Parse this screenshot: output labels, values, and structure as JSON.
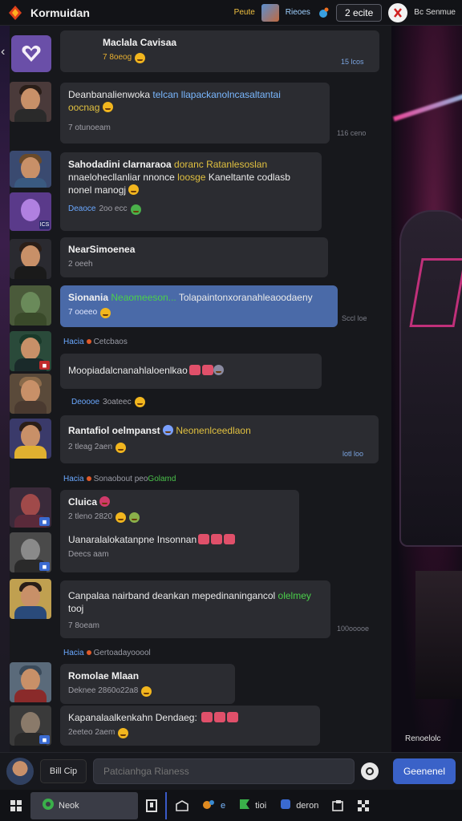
{
  "topbar": {
    "title": "Kormuidan",
    "link": "Peute",
    "chip": "Rieoes",
    "pill": "2 ecite",
    "user": "Bc Senmue"
  },
  "messages": [
    {
      "name": "Maclala Cavisaa",
      "meta": "7 8oeog",
      "stamp": "15 lcos"
    },
    {
      "text_a": "Deanbanalienwoka ",
      "text_b": "telcan llapackanolncasaltantai",
      "text_c": "oocnag",
      "meta": "7 otunoeam",
      "stamp": "116 ceno"
    },
    {
      "text_a": "Sahodadini clarnaraoa",
      "text_b": " doranc Ratanlesoslan",
      "text_c": "nnaelohecllanliar nnonce ",
      "text_d": "loosge",
      "text_e": " Kaneltante codlasb",
      "text_f": "nonel manogj",
      "meta": "Deaoce",
      "meta2": "2oo ecc"
    },
    {
      "name": "NearSimoenea",
      "meta": "2 oeeh"
    },
    {
      "name": "Sionania",
      "text_b": " Neaomeeson...",
      "text_c": " Tolapaintonxoranahleaoodaeny",
      "meta": "7 ooeeo",
      "stamp": "Sccl loe"
    },
    {
      "sys_a": "Hacia",
      "sys_b": "Cetcbaos"
    },
    {
      "text_a": "Moopiadalcnanahlaloenlkao",
      "meta": "Deoooe",
      "meta2": "3oateec"
    },
    {
      "name": "Rantafiol oelmpanst",
      "text_b": " Neonenlceedlaon",
      "meta": "2 tleag 2aen",
      "stamp": "lotl loo"
    },
    {
      "sys_a": "Hacia",
      "sys_b": "Sonaobout peo",
      "sys_c": "Golamd"
    },
    {
      "name": "Cluica",
      "meta": "2 tleno 2820"
    },
    {
      "text_a": "Uanaralalokatanpne Insonnan",
      "meta": "Deecs aam"
    },
    {
      "text_a": "Canpalaa nairband deankan mepedinaningancol ",
      "text_b": "olelmey",
      "text_c": "tooj",
      "meta": "7 8oeam",
      "stamp": "100ooooe"
    },
    {
      "sys_a": "Hacia",
      "sys_b": "Gertoaday",
      "sys_c": "ooool"
    },
    {
      "name": "Romolae Mlaan",
      "meta": "Deknee 2860o22a8"
    },
    {
      "text_a": "Kapanalaalkenkahn Dendaeg:",
      "meta": "2eeteo 2aem"
    }
  ],
  "input": {
    "attach_label": "Bill Cip",
    "placeholder": "Patcianhga Rianess",
    "send_label": "Geenenel"
  },
  "bg_caption": "Renoelolc",
  "nav": [
    {
      "label": "Neok"
    },
    {
      "label": ""
    },
    {
      "label": ""
    },
    {
      "label": "e"
    },
    {
      "label": "tioi"
    },
    {
      "label": "deron"
    },
    {
      "label": ""
    },
    {
      "label": ""
    }
  ]
}
